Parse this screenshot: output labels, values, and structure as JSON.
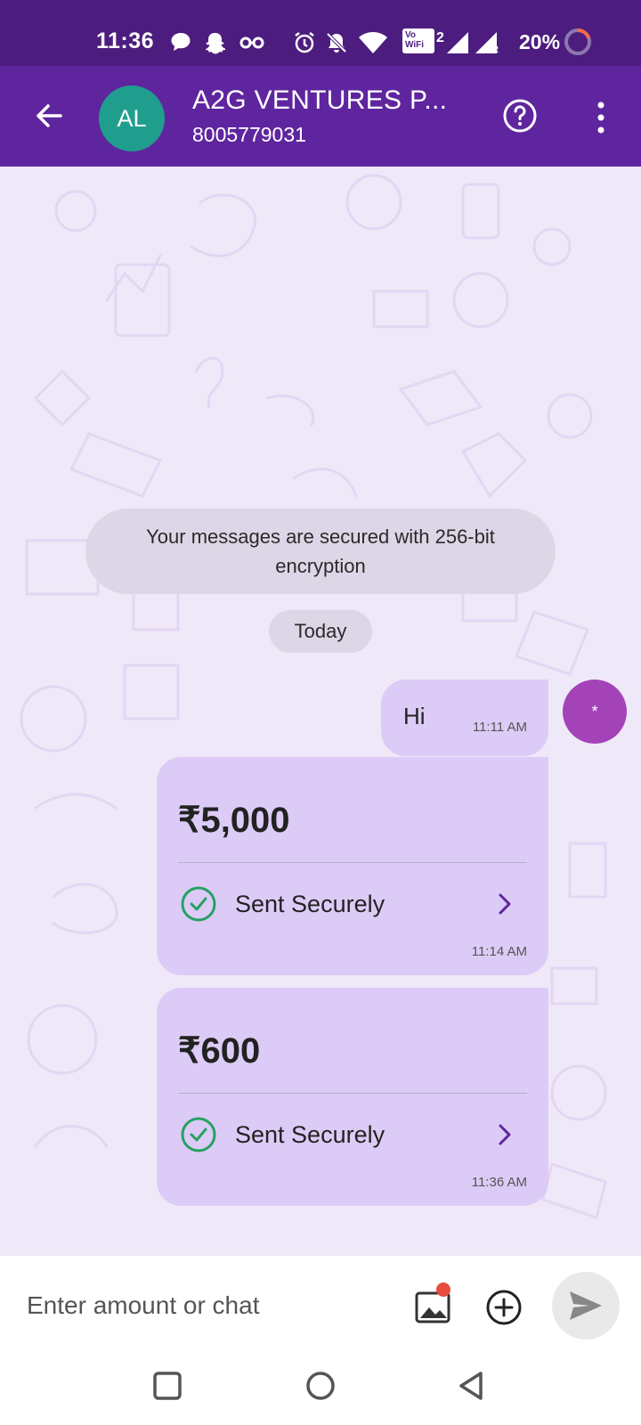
{
  "status_bar": {
    "time": "11:36",
    "volte_line1": "Vo",
    "volte_line2": "WiFi",
    "volte_sim": "2",
    "roaming": "R",
    "battery": "20%"
  },
  "header": {
    "avatar_initials": "AL",
    "contact_name": "A2G VENTURES P...",
    "contact_phone": "8005779031"
  },
  "chat": {
    "encryption_notice": "Your messages are secured with 256-bit encryption",
    "date_label": "Today",
    "messages": [
      {
        "text": "Hi",
        "time": "11:11 AM"
      }
    ],
    "self_avatar": "*",
    "payments": [
      {
        "amount": "₹5,000",
        "status": "Sent Securely",
        "time": "11:14 AM"
      },
      {
        "amount": "₹600",
        "status": "Sent Securely",
        "time": "11:36 AM"
      }
    ]
  },
  "input_bar": {
    "placeholder": "Enter amount or chat"
  },
  "colors": {
    "header": "#5f259f",
    "status_bar": "#4c1d7e",
    "bubble": "#dccbf6",
    "success": "#26a162",
    "accent": "#5f259f"
  }
}
